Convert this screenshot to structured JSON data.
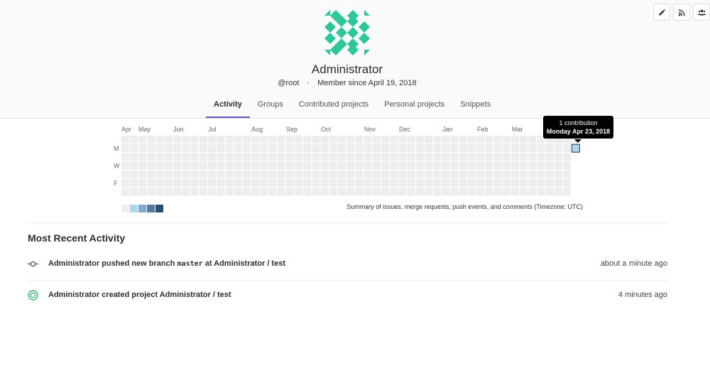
{
  "profile": {
    "name": "Administrator",
    "username": "@root",
    "separator": "·",
    "member_since": "Member since April 19, 2018"
  },
  "header_actions": [
    {
      "icon": "pencil-icon",
      "label": "Edit profile"
    },
    {
      "icon": "rss-icon",
      "label": "Subscribe"
    },
    {
      "icon": "users-icon",
      "label": "Admin"
    }
  ],
  "tabs": [
    {
      "label": "Activity",
      "active": true
    },
    {
      "label": "Groups",
      "active": false
    },
    {
      "label": "Contributed projects",
      "active": false
    },
    {
      "label": "Personal projects",
      "active": false
    },
    {
      "label": "Snippets",
      "active": false
    }
  ],
  "calendar": {
    "months": [
      "Apr",
      "May",
      "Jun",
      "Jul",
      "Aug",
      "Sep",
      "Oct",
      "Nov",
      "Dec",
      "Jan",
      "Feb",
      "Mar"
    ],
    "day_labels": [
      "M",
      "W",
      "F"
    ],
    "weeks": 53,
    "contribution": {
      "count": 1,
      "date": "Monday Apr 23, 2018",
      "week_index": 52,
      "day_index": 1
    },
    "tooltip_title": "1 contribution",
    "tooltip_date": "Monday Apr 23, 2018",
    "summary": "Summary of issues, merge requests, push events, and comments (Timezone: UTC)",
    "colors": {
      "empty": "#ededed",
      "legend": [
        "#ededed",
        "#acd5f2",
        "#7fa8c9",
        "#527ba0",
        "#254e77"
      ],
      "highlight_fill": "#acd5f2",
      "highlight_stroke": "#333333"
    }
  },
  "recent_activity": {
    "title": "Most Recent Activity",
    "events": [
      {
        "icon": "commit-icon",
        "prefix": "Administrator pushed new branch ",
        "code": "master",
        "suffix": " at Administrator / test",
        "time": "about a minute ago"
      },
      {
        "icon": "project-created-icon",
        "prefix": "Administrator created project Administrator / test",
        "code": "",
        "suffix": "",
        "time": "4 minutes ago"
      }
    ]
  }
}
